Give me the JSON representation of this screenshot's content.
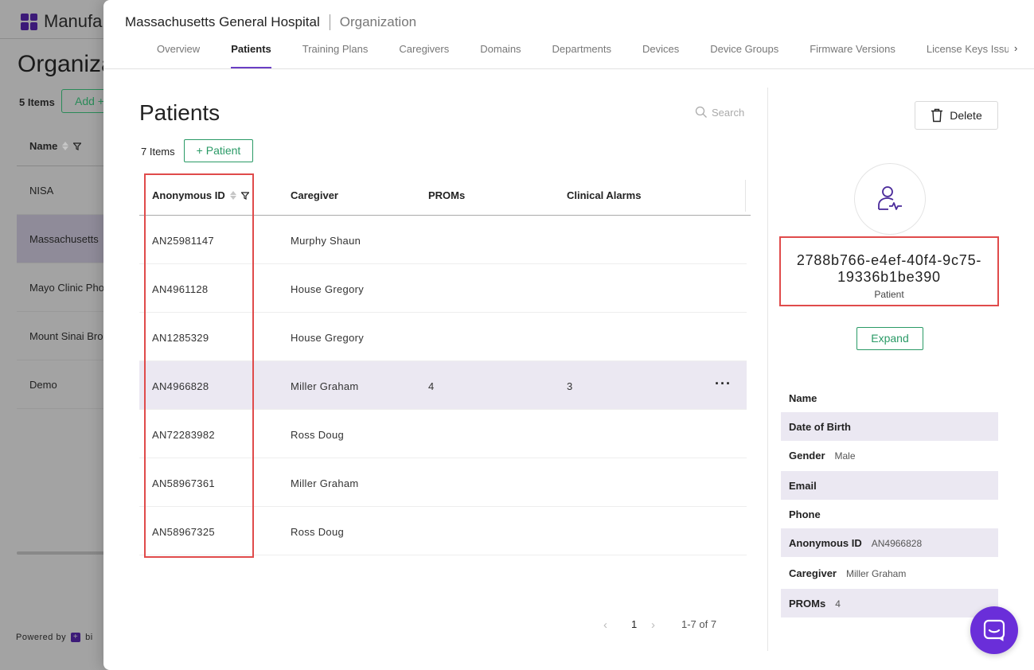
{
  "background": {
    "brand": "Manufa",
    "title": "Organiza",
    "count": "5 Items",
    "add_label": "Add +",
    "column_name": "Name",
    "rows": [
      "NISA",
      "Massachusetts",
      "Mayo Clinic Pho",
      "Mount Sinai Bro",
      "Demo"
    ],
    "powered_by": "Powered by",
    "powered_brand": "bi"
  },
  "header": {
    "organization": "Massachusetts General Hospital",
    "section": "Organization",
    "tabs": [
      {
        "label": "Overview"
      },
      {
        "label": "Patients"
      },
      {
        "label": "Training Plans"
      },
      {
        "label": "Caregivers"
      },
      {
        "label": "Domains"
      },
      {
        "label": "Departments"
      },
      {
        "label": "Devices"
      },
      {
        "label": "Device Groups"
      },
      {
        "label": "Firmware Versions"
      },
      {
        "label": "License Keys Issu"
      }
    ],
    "more_glyph": "›"
  },
  "patients": {
    "title": "Patients",
    "search_placeholder": "Search",
    "count": "7 Items",
    "add_label": "+ Patient",
    "columns": [
      "Anonymous ID",
      "Caregiver",
      "PROMs",
      "Clinical Alarms"
    ],
    "rows": [
      {
        "id": "AN25981147",
        "caregiver": "Murphy Shaun",
        "proms": "",
        "alarms": ""
      },
      {
        "id": "AN4961128",
        "caregiver": "House Gregory",
        "proms": "",
        "alarms": ""
      },
      {
        "id": "AN1285329",
        "caregiver": "House Gregory",
        "proms": "",
        "alarms": ""
      },
      {
        "id": "AN4966828",
        "caregiver": "Miller Graham",
        "proms": "4",
        "alarms": "3",
        "menu": "···"
      },
      {
        "id": "AN72283982",
        "caregiver": "Ross Doug",
        "proms": "",
        "alarms": ""
      },
      {
        "id": "AN58967361",
        "caregiver": "Miller Graham",
        "proms": "",
        "alarms": ""
      },
      {
        "id": "AN58967325",
        "caregiver": "Ross Doug",
        "proms": "",
        "alarms": ""
      }
    ],
    "pagination": {
      "prev": "‹",
      "page": "1",
      "next": "›",
      "range": "1-7 of 7"
    }
  },
  "detail": {
    "delete_label": "Delete",
    "patient_uuid": "2788b766-e4ef-40f4-9c75-19336b1be390",
    "patient_label": "Patient",
    "expand_label": "Expand",
    "fields": [
      {
        "key": "Name",
        "value": ""
      },
      {
        "key": "Date of Birth",
        "value": ""
      },
      {
        "key": "Gender",
        "value": "Male"
      },
      {
        "key": "Email",
        "value": ""
      },
      {
        "key": "Phone",
        "value": ""
      },
      {
        "key": "Anonymous ID",
        "value": "AN4966828"
      },
      {
        "key": "Caregiver",
        "value": "Miller Graham"
      },
      {
        "key": "PROMs",
        "value": "4"
      }
    ]
  },
  "colors": {
    "accent": "#6a3ec4",
    "action_green": "#2a9a66",
    "highlight_red": "#e04b4b",
    "selected_row": "#ebe8f2",
    "chat_button": "#6a2ed9"
  },
  "icons": [
    "search-icon",
    "delete-icon",
    "patient-icon",
    "sort-icon",
    "filter-icon",
    "chat-icon",
    "chevron-right-icon"
  ]
}
